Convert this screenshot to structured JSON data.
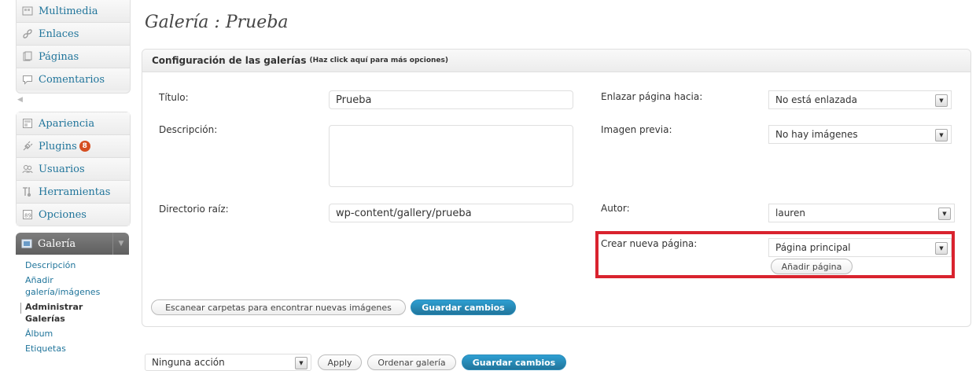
{
  "sidebar": {
    "top_items": [
      {
        "label": "Multimedia",
        "icon": "media-icon"
      },
      {
        "label": "Enlaces",
        "icon": "link-icon"
      },
      {
        "label": "Páginas",
        "icon": "pages-icon"
      },
      {
        "label": "Comentarios",
        "icon": "comments-icon"
      }
    ],
    "mid_items": [
      {
        "label": "Apariencia",
        "icon": "appearance-icon"
      },
      {
        "label": "Plugins",
        "icon": "plugins-icon",
        "badge": "8"
      },
      {
        "label": "Usuarios",
        "icon": "users-icon"
      },
      {
        "label": "Herramientas",
        "icon": "tools-icon"
      },
      {
        "label": "Opciones",
        "icon": "settings-icon"
      }
    ],
    "gallery_menu": {
      "label": "Galería",
      "sub_items": [
        {
          "label": "Descripción"
        },
        {
          "label": "Añadir galería/imágenes"
        },
        {
          "label": "Administrar Galerías",
          "current": true
        },
        {
          "label": "Álbum"
        },
        {
          "label": "Etiquetas"
        }
      ]
    }
  },
  "page": {
    "title": "Galería : Prueba"
  },
  "options": {
    "header": "Configuración de las galerías",
    "header_hint": "(Haz click aquí para más opciones)",
    "fields": {
      "titulo_label": "Título:",
      "titulo_value": "Prueba",
      "descripcion_label": "Descripción:",
      "descripcion_value": "",
      "directorio_label": "Directorio raíz:",
      "directorio_value": "wp-content/gallery/prueba",
      "enlazar_label": "Enlazar página hacia:",
      "enlazar_value": "No está enlazada",
      "imagen_label": "Imagen previa:",
      "imagen_value": "No hay imágenes",
      "autor_label": "Autor:",
      "autor_value": "lauren",
      "crear_label": "Crear nueva página:",
      "crear_value": "Página principal",
      "anadir_button": "Añadir página"
    },
    "scan_button": "Escanear carpetas para encontrar nuevas imágenes",
    "save_button": "Guardar cambios"
  },
  "bulk": {
    "action_value": "Ninguna acción",
    "apply_button": "Apply",
    "sort_button": "Ordenar galería",
    "save_button": "Guardar cambios"
  },
  "colors": {
    "link": "#21759b",
    "highlight": "#d9232e",
    "primary_button": "#21759b",
    "badge": "#d54e21"
  }
}
